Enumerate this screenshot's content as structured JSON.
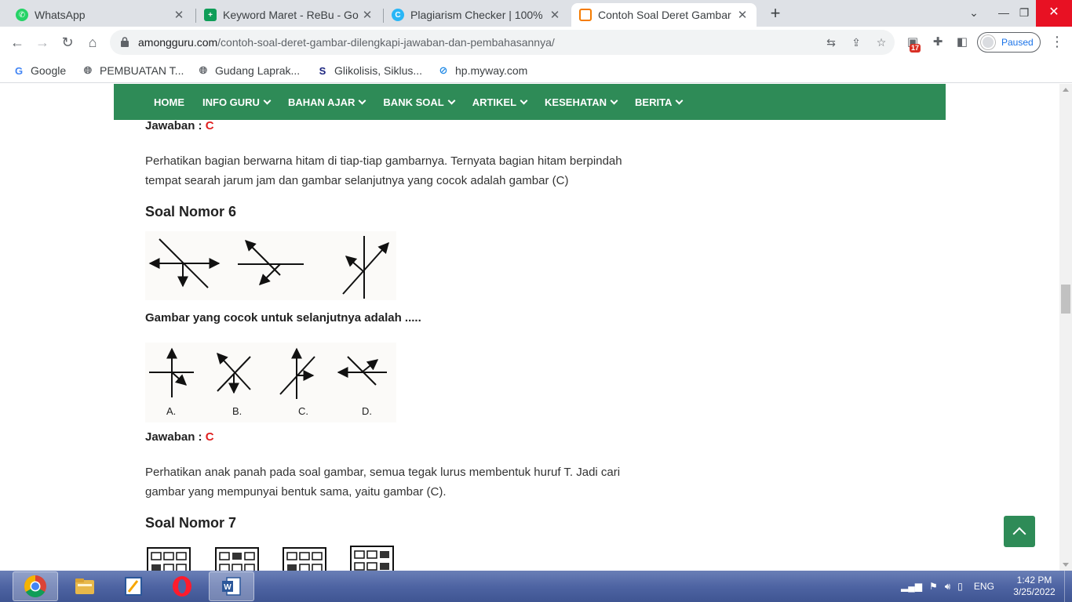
{
  "browser": {
    "tabs": [
      {
        "title": "WhatsApp",
        "icon": "whatsapp-icon",
        "color": "#25d366"
      },
      {
        "title": "Keyword Maret - ReBu - Go",
        "icon": "sheets-icon",
        "color": "#0f9d58"
      },
      {
        "title": "Plagiarism Checker | 100%",
        "icon": "plagiarism-icon",
        "color": "#29b6f6"
      },
      {
        "title": "Contoh Soal Deret Gambar",
        "icon": "amongguru-icon",
        "color": "#f57c00"
      }
    ],
    "new_tab_label": "+",
    "address": {
      "domain": "amongguru.com",
      "path": "/contoh-soal-deret-gambar-dilengkapi-jawaban-dan-pembahasannya/"
    },
    "extension_badge": "17",
    "profile_status": "Paused",
    "bookmarks": [
      {
        "label": "Google",
        "icon": "google-icon"
      },
      {
        "label": "PEMBUATAN T...",
        "icon": "globe-icon"
      },
      {
        "label": "Gudang Laprak...",
        "icon": "globe-icon"
      },
      {
        "label": "Glikolisis, Siklus...",
        "icon": "hotspot-icon"
      },
      {
        "label": "hp.myway.com",
        "icon": "myway-icon"
      }
    ]
  },
  "site": {
    "nav": [
      {
        "label": "HOME",
        "dropdown": false
      },
      {
        "label": "INFO GURU",
        "dropdown": true
      },
      {
        "label": "BAHAN AJAR",
        "dropdown": true
      },
      {
        "label": "BANK SOAL",
        "dropdown": true
      },
      {
        "label": "ARTIKEL",
        "dropdown": true
      },
      {
        "label": "KESEHATAN",
        "dropdown": true
      },
      {
        "label": "BERITA",
        "dropdown": true
      }
    ],
    "accent_color": "#2e8b57"
  },
  "article": {
    "answer_label": "Jawaban",
    "answer_sep": " : ",
    "q5_answer": "C",
    "q5_explanation": "Perhatikan bagian berwarna hitam di tiap-tiap gambarnya. Ternyata bagian hitam berpindah tempat searah jarum jam dan gambar selanjutnya yang cocok adalah gambar (C)",
    "q6_heading": "Soal Nomor 6",
    "q6_question": "Gambar yang cocok untuk selanjutnya adalah .....",
    "q6_options": [
      "A.",
      "B.",
      "C.",
      "D."
    ],
    "q6_answer": "C",
    "q6_explanation": "Perhatikan anak panah pada soal gambar, semua tegak lurus membentuk huruf  T. Jadi cari gambar yang mempunyai bentuk sama, yaitu gambar (C).",
    "q7_heading": "Soal Nomor 7"
  },
  "taskbar": {
    "apps": [
      "chrome-icon",
      "file-explorer-icon",
      "notes-icon",
      "opera-icon",
      "word-icon"
    ],
    "language": "ENG",
    "time": "1:42 PM",
    "date": "3/25/2022"
  }
}
